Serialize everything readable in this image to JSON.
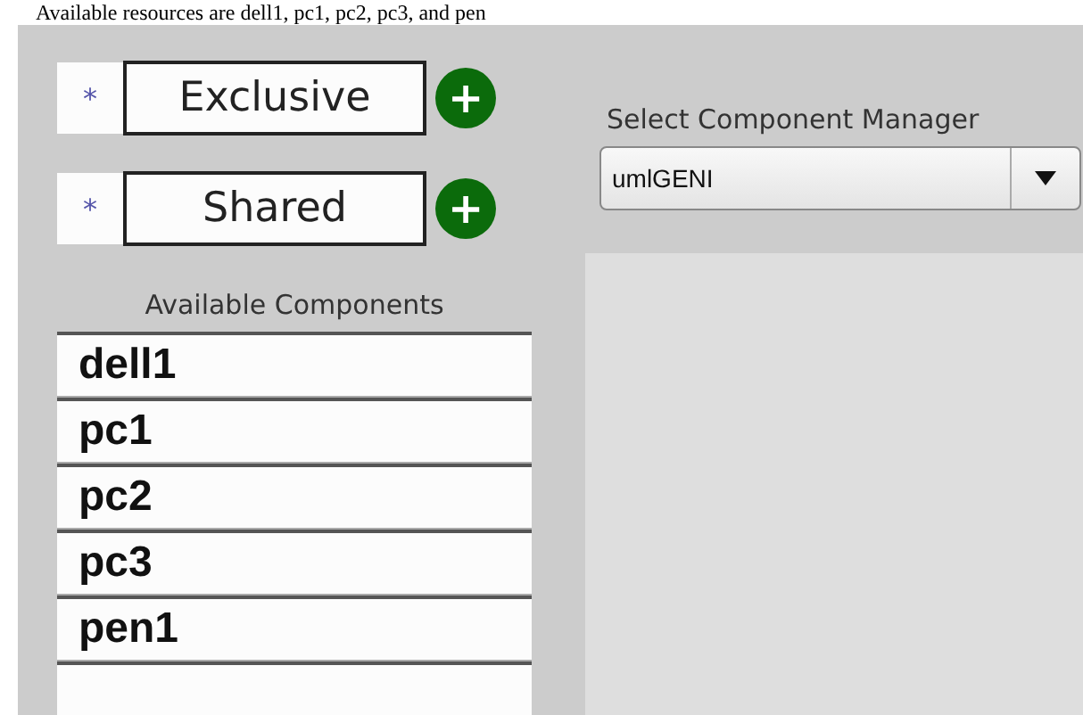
{
  "caption": "Available resources are dell1, pc1, pc2, pc3, and pen",
  "sharing": [
    {
      "marker": "*",
      "label": "Exclusive",
      "add": "+"
    },
    {
      "marker": "*",
      "label": "Shared",
      "add": "+"
    }
  ],
  "available_components": {
    "title": "Available Components",
    "items": [
      "dell1",
      "pc1",
      "pc2",
      "pc3",
      "pen1"
    ]
  },
  "component_manager": {
    "label": "Select Component Manager",
    "value": "umlGENI"
  }
}
